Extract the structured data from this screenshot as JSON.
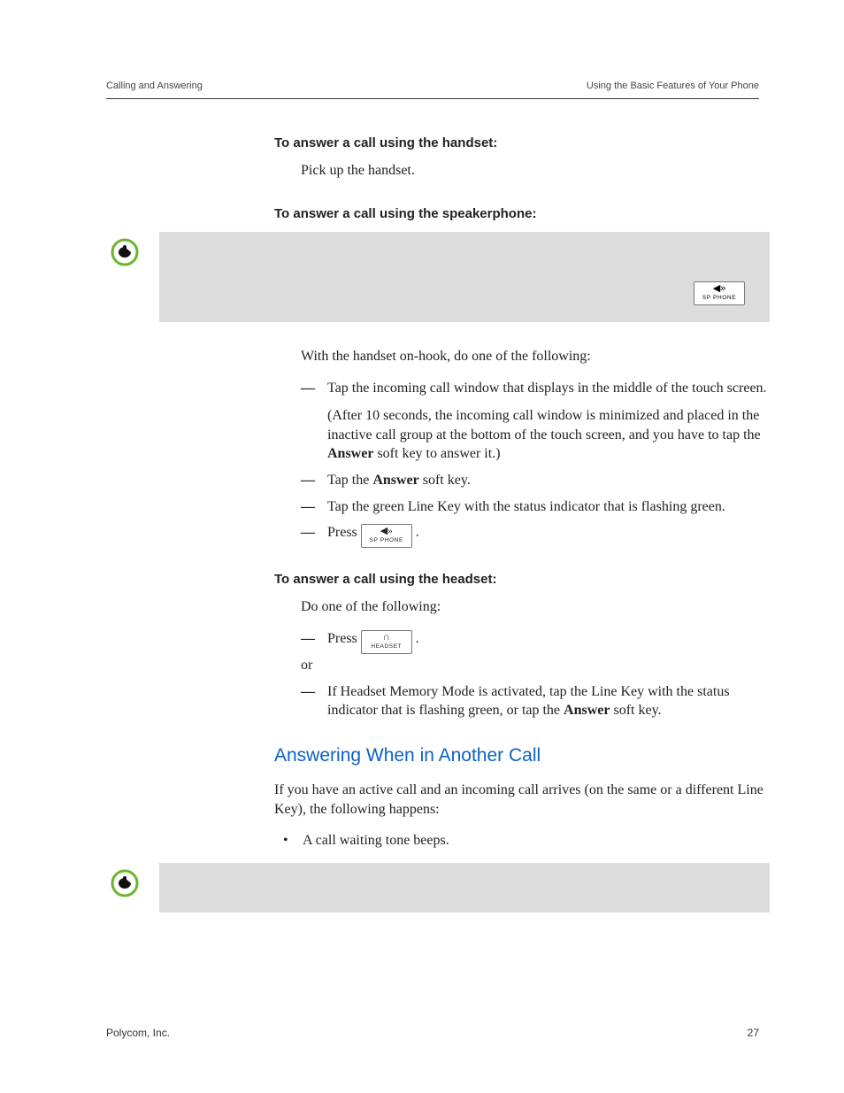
{
  "header": {
    "left": "Calling and Answering",
    "right": "Using the Basic Features of Your Phone"
  },
  "colors": {
    "section_heading": "#0d60c3",
    "note_bg": "#dcdcdc",
    "note_ring": "#6fb42e"
  },
  "buttons": {
    "sp_phone": {
      "glyph": "◀»",
      "label": "SP PHONE"
    },
    "headset": {
      "glyph": "∩",
      "label": "HEADSET"
    }
  },
  "sections": {
    "handset": {
      "heading": "To answer a call using the handset:",
      "body": "Pick up the handset."
    },
    "speaker": {
      "heading": "To answer a call using the speakerphone:",
      "after_note_intro": "With the handset on-hook, do one of the following:",
      "items": {
        "tap_window": "Tap the incoming call window that displays in the middle of the touch screen.",
        "tap_window_after": "(After 10 seconds, the incoming call window is minimized and placed in the inactive call group at the bottom of the touch screen, and you have to tap the ",
        "tap_window_after_bold": "Answer",
        "tap_window_after_tail": " soft key to answer it.)",
        "tap_answer_pre": "Tap the ",
        "tap_answer_bold": "Answer",
        "tap_answer_post": " soft key.",
        "tap_linekey": "Tap the green Line Key with the status indicator that is flashing green.",
        "press_prefix": "Press ",
        "press_suffix": "."
      }
    },
    "headset": {
      "heading": "To answer a call using the headset:",
      "intro": "Do one of the following:",
      "press_prefix": "Press ",
      "press_suffix": ".",
      "or": "or",
      "memory_pre": "If Headset Memory Mode is activated, tap the Line Key with the status indicator that is flashing green, or tap the ",
      "memory_bold": "Answer",
      "memory_post": " soft key."
    },
    "another_call": {
      "heading": "Answering When in Another Call",
      "para": "If you have an active call and an incoming call arrives (on the same or a different Line Key), the following happens:",
      "bullet1": "A call waiting tone beeps."
    }
  },
  "footer": {
    "left": "Polycom, Inc.",
    "right": "27"
  }
}
